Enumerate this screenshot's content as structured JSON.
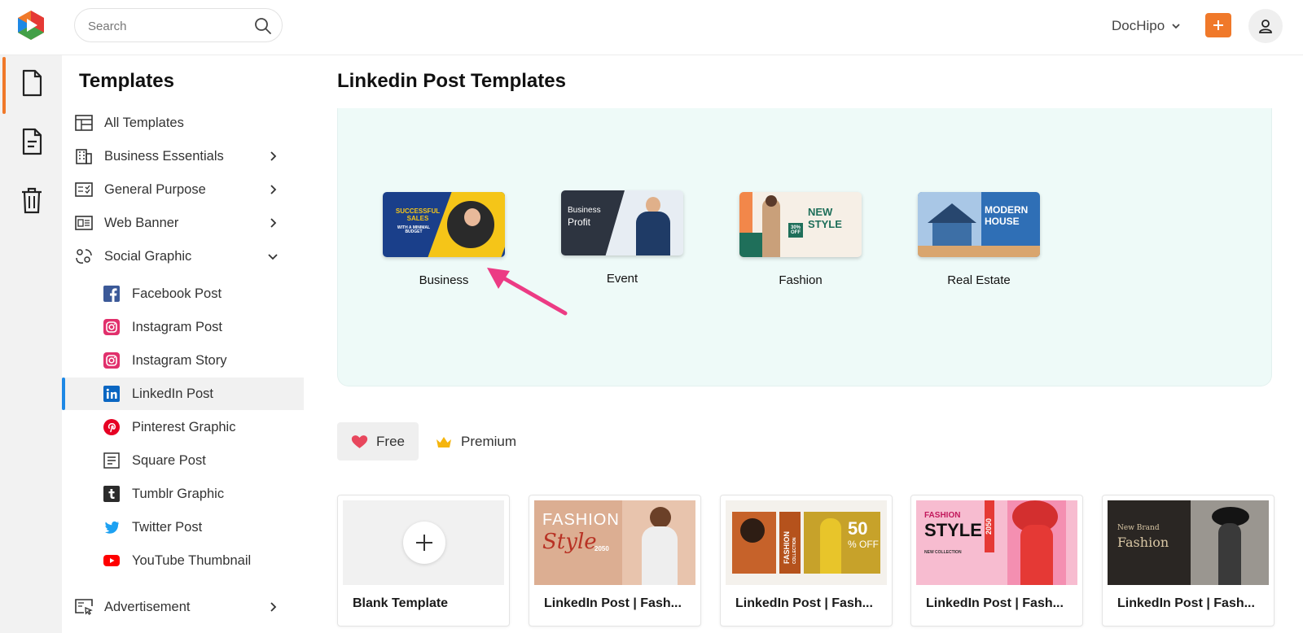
{
  "topbar": {
    "search_placeholder": "Search",
    "account_label": "DocHipo",
    "colors": {
      "accent": "#f0792a"
    }
  },
  "sidebar": {
    "title": "Templates",
    "items": [
      {
        "label": "All Templates",
        "icon": "layout-icon"
      },
      {
        "label": "Business Essentials",
        "icon": "building-icon"
      },
      {
        "label": "General Purpose",
        "icon": "checklist-icon"
      },
      {
        "label": "Web Banner",
        "icon": "banner-icon"
      },
      {
        "label": "Social Graphic",
        "icon": "social-icon"
      }
    ],
    "social_sub": [
      {
        "label": "Facebook Post",
        "icon": "facebook-icon"
      },
      {
        "label": "Instagram Post",
        "icon": "instagram-icon"
      },
      {
        "label": "Instagram Story",
        "icon": "instagram-icon"
      },
      {
        "label": "LinkedIn Post",
        "icon": "linkedin-icon",
        "active": true
      },
      {
        "label": "Pinterest Graphic",
        "icon": "pinterest-icon"
      },
      {
        "label": "Square Post",
        "icon": "document-icon"
      },
      {
        "label": "Tumblr Graphic",
        "icon": "tumblr-icon"
      },
      {
        "label": "Twitter Post",
        "icon": "twitter-icon"
      },
      {
        "label": "YouTube Thumbnail",
        "icon": "youtube-icon"
      }
    ],
    "bottom_item": {
      "label": "Advertisement",
      "icon": "advertisement-icon"
    }
  },
  "main": {
    "title": "Linkedin Post Templates",
    "categories": [
      {
        "name": "Business",
        "thumb_text": "SUCCESSFUL SALES",
        "thumb_sub": "WITH A MINIMAL BUDGET"
      },
      {
        "name": "Event",
        "thumb_text": "Business",
        "thumb_sub": "Profit"
      },
      {
        "name": "Fashion",
        "thumb_text": "NEW",
        "thumb_sub": "STYLE",
        "badge": "30% OFF"
      },
      {
        "name": "Real Estate",
        "thumb_text": "MODERN",
        "thumb_sub": "HOUSE"
      }
    ],
    "filters": {
      "free": "Free",
      "premium": "Premium"
    },
    "cards": [
      {
        "title": "Blank Template"
      },
      {
        "title": "LinkedIn Post | Fash...",
        "thumb_text": "FASHION",
        "thumb_sub": "Style",
        "thumb_year": "2050"
      },
      {
        "title": "LinkedIn Post | Fash...",
        "thumb_text": "FASHION",
        "thumb_sub": "COLLECTION",
        "badge": "50",
        "badge_sub": "% OFF"
      },
      {
        "title": "LinkedIn Post | Fash...",
        "thumb_text": "FASHION",
        "thumb_sub": "STYLE",
        "thumb_year": "2050",
        "thumb_caption": "NEW COLLECTION"
      },
      {
        "title": "LinkedIn Post | Fash...",
        "thumb_text": "Fashion",
        "thumb_sub": "New Brand"
      }
    ]
  }
}
